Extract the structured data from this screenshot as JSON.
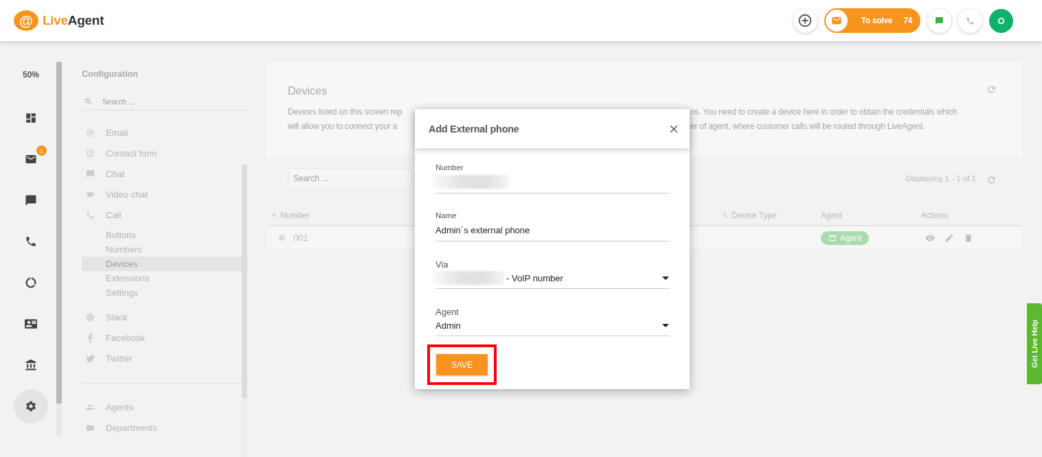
{
  "header": {
    "logo": {
      "mark": "@",
      "accent": "Live",
      "rest": "Agent"
    },
    "to_solve": {
      "label": "To solve",
      "count": "74"
    },
    "avatar": "O"
  },
  "rail": {
    "zoom": "50%",
    "items": [
      {
        "kind": "dashboard",
        "selected": false
      },
      {
        "kind": "email",
        "selected": false,
        "badge": "1"
      },
      {
        "kind": "chat",
        "selected": false
      },
      {
        "kind": "call",
        "selected": false
      },
      {
        "kind": "reports",
        "selected": false
      },
      {
        "kind": "contacts",
        "selected": false
      },
      {
        "kind": "knowledgebase",
        "selected": false
      },
      {
        "kind": "settings",
        "selected": true
      }
    ]
  },
  "config": {
    "title": "Configuration",
    "search": {
      "placeholder": "Search ..."
    },
    "groups": [
      {
        "items": [
          {
            "kind": "email",
            "label": "Email",
            "selected": false
          },
          {
            "kind": "form",
            "label": "Contact form",
            "selected": false
          },
          {
            "kind": "chat",
            "label": "Chat",
            "selected": false
          },
          {
            "kind": "video",
            "label": "Video chat",
            "selected": false
          },
          {
            "kind": "call",
            "label": "Call",
            "selected": false,
            "children": [
              {
                "label": "Buttons",
                "selected": false
              },
              {
                "label": "Numbers",
                "selected": false
              },
              {
                "label": "Devices",
                "selected": true
              },
              {
                "label": "Extensions",
                "selected": false
              },
              {
                "label": "Settings",
                "selected": false
              }
            ]
          },
          {
            "kind": "slack",
            "label": "Slack",
            "selected": false
          },
          {
            "kind": "facebook",
            "label": "Facebook",
            "selected": false
          },
          {
            "kind": "twitter",
            "label": "Twitter",
            "selected": false
          }
        ]
      },
      {
        "items": [
          {
            "kind": "agents",
            "label": "Agents",
            "selected": false
          },
          {
            "kind": "departments",
            "label": "Departments",
            "selected": false
          }
        ]
      }
    ]
  },
  "devices": {
    "title": "Devices",
    "description": [
      {
        "start": "Devices listed on this screen rep",
        "end": "ns. You need to create a device here in order to obtain the credentials which"
      },
      {
        "start": "will allow you to connect your a",
        "end": "er of agent, where customer calls will be routed through LiveAgent."
      }
    ],
    "search": {
      "placeholder": "Search ..."
    },
    "displaying": "Displaying 1 - 1 of 1",
    "table": {
      "columns": [
        {
          "label": "Number",
          "kind": "sorted"
        },
        {
          "label": "Device Type",
          "kind": "sortable"
        },
        {
          "label": "Agent",
          "kind": "plain"
        },
        {
          "label": "Actions",
          "kind": "plain"
        }
      ],
      "rows": [
        {
          "number": "001",
          "agent": "Agent"
        }
      ]
    }
  },
  "dialog": {
    "title": "Add External phone",
    "fields": [
      {
        "label": "Number",
        "kind": "text",
        "redacted": true
      },
      {
        "label": "Name",
        "kind": "text",
        "value": "Admin´s external phone"
      },
      {
        "label": "Via",
        "kind": "select",
        "redacted": true,
        "value": "- VoIP number"
      },
      {
        "label": "Agent",
        "kind": "select",
        "value": "Admin"
      }
    ],
    "save": "SAVE",
    "save_highlighted": true
  },
  "live_help": "Get Live Help"
}
